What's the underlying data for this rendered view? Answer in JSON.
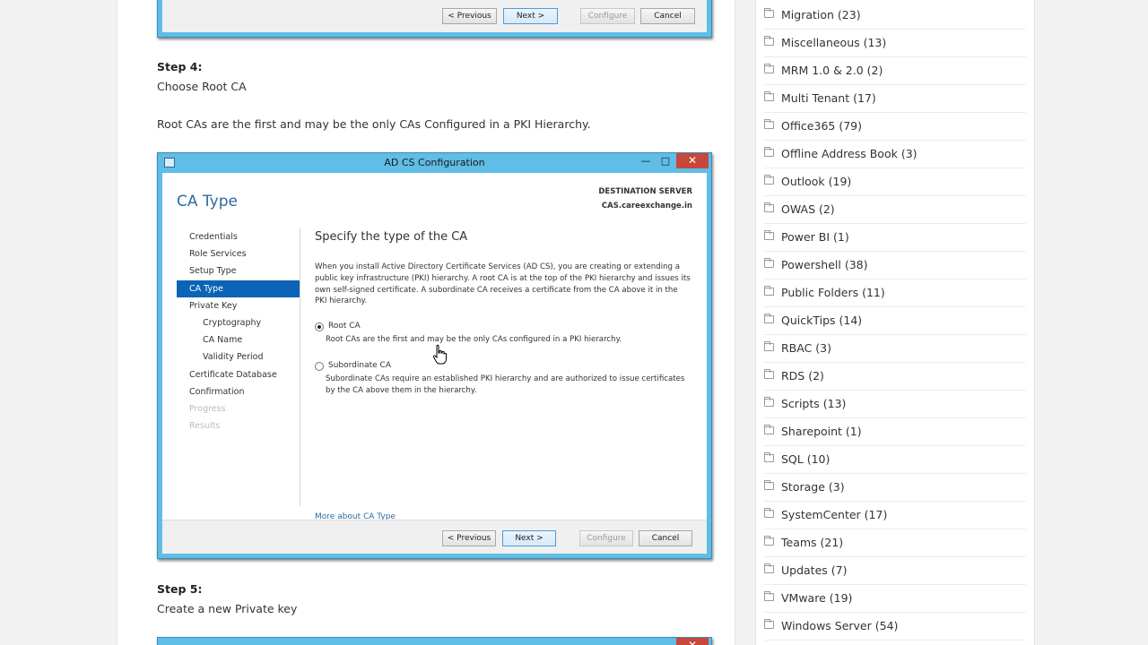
{
  "wizard_buttons": {
    "previous": "< Previous",
    "next": "Next >",
    "configure": "Configure",
    "cancel": "Cancel"
  },
  "step4": {
    "label": "Step 4:",
    "instruction": "Choose Root CA",
    "explanation": "Root CAs are the first and may be the only CAs Configured in a PKI Hierarchy."
  },
  "dialog": {
    "title": "AD CS Configuration",
    "heading": "CA Type",
    "destination_label": "DESTINATION SERVER",
    "destination_value": "CAS.careexchange.in",
    "nav_items": {
      "credentials": "Credentials",
      "role_services": "Role Services",
      "setup_type": "Setup Type",
      "ca_type": "CA Type",
      "private_key": "Private Key",
      "cryptography": "Cryptography",
      "ca_name": "CA Name",
      "validity_period": "Validity Period",
      "certificate_database": "Certificate Database",
      "confirmation": "Confirmation",
      "progress": "Progress",
      "results": "Results"
    },
    "content_title": "Specify the type of the CA",
    "intro": "When you install Active Directory Certificate Services (AD CS), you are creating or extending a public key infrastructure (PKI) hierarchy. A root CA is at the top of the PKI hierarchy and issues its own self-signed certificate. A subordinate CA receives a certificate from the CA above it in the PKI hierarchy.",
    "option_root_label": "Root CA",
    "option_root_desc": "Root CAs are the first and may be the only CAs configured in a PKI hierarchy.",
    "option_sub_label": "Subordinate CA",
    "option_sub_desc": "Subordinate CAs require an established PKI hierarchy and are authorized to issue certificates by the CA above them in the hierarchy.",
    "more_link": "More about CA Type",
    "selected_option": "Root CA"
  },
  "step5": {
    "label": "Step 5:",
    "instruction": "Create a new Private key"
  },
  "categories": [
    "Migration (23)",
    "Miscellaneous (13)",
    "MRM 1.0 & 2.0 (2)",
    "Multi Tenant (17)",
    "Office365 (79)",
    "Offline Address Book (3)",
    "Outlook (19)",
    "OWAS (2)",
    "Power BI (1)",
    "Powershell (38)",
    "Public Folders (11)",
    "QuickTips (14)",
    "RBAC (3)",
    "RDS (2)",
    "Scripts (13)",
    "Sharepoint (1)",
    "SQL (10)",
    "Storage (3)",
    "SystemCenter (17)",
    "Teams (21)",
    "Updates (7)",
    "VMware (19)",
    "Windows Server (54)"
  ],
  "icons": {
    "category": "folder-icon",
    "cursor": "hand-pointer-icon",
    "window_app": "server-manager-icon"
  },
  "colors": {
    "window_frame": "#5fbde6",
    "nav_active": "#0b63b6",
    "heading_blue": "#2c6aa0",
    "close_button": "#c7473a"
  }
}
